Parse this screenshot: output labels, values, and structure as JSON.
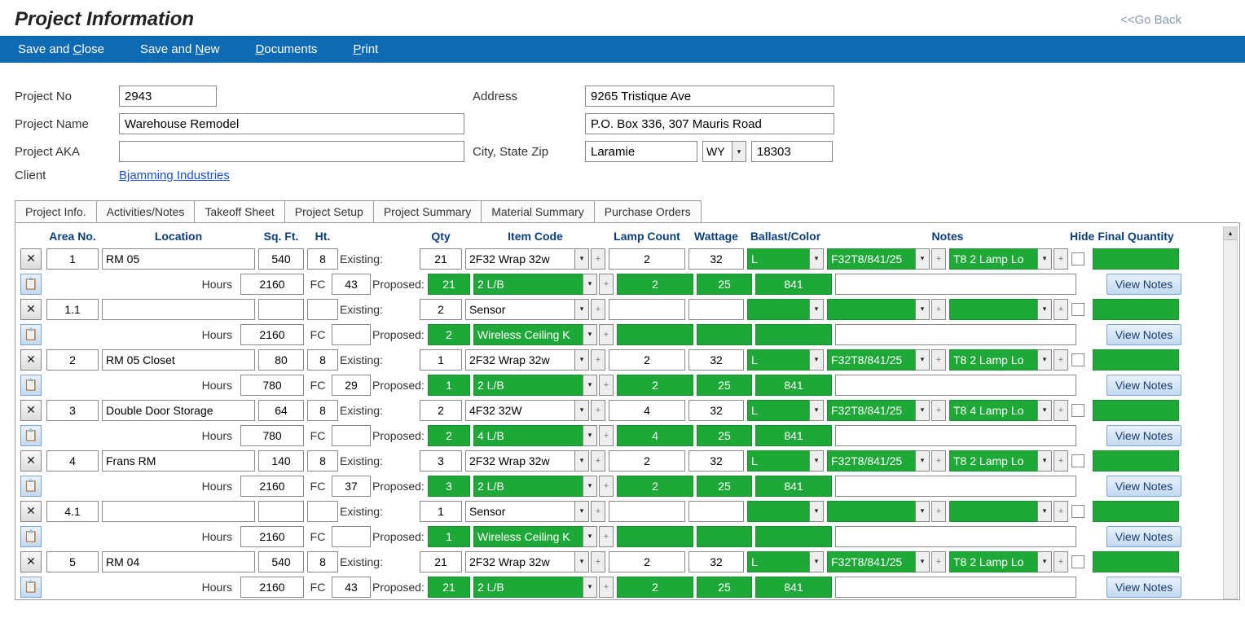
{
  "header": {
    "title": "Project Information",
    "go_back": "<<Go Back"
  },
  "toolbar": {
    "save_close": "Save and Close",
    "save_new": "Save and New",
    "documents": "Documents",
    "print": "Print"
  },
  "form": {
    "project_no_label": "Project No",
    "project_no": "2943",
    "project_name_label": "Project Name",
    "project_name": "Warehouse Remodel",
    "project_aka_label": "Project AKA",
    "project_aka": "",
    "client_label": "Client",
    "client": "Bjamming Industries",
    "address_label": "Address",
    "address1": "9265 Tristique Ave",
    "address2": "P.O. Box 336, 307 Mauris Road",
    "csz_label": "City, State Zip",
    "city": "Laramie",
    "state": "WY",
    "zip": "18303"
  },
  "tabs": [
    "Project Info.",
    "Activities/Notes",
    "Takeoff Sheet",
    "Project Setup",
    "Project Summary",
    "Material Summary",
    "Purchase Orders"
  ],
  "active_tab": 2,
  "columns": {
    "area": "Area No.",
    "location": "Location",
    "sqft": "Sq. Ft.",
    "ht": "Ht.",
    "qty": "Qty",
    "item": "Item Code",
    "lamp": "Lamp Count",
    "watt": "Wattage",
    "ballast": "Ballast/Color",
    "notes": "Notes",
    "hide": "Hide",
    "final": "Final Quantity"
  },
  "labels": {
    "existing": "Existing:",
    "proposed": "Proposed:",
    "hours": "Hours",
    "fc": "FC",
    "view_notes": "View Notes"
  },
  "rows": [
    {
      "area": "1",
      "location": "RM 05",
      "sqft": "540",
      "ht": "8",
      "hours": "2160",
      "fc": "43",
      "ex": {
        "qty": "21",
        "item": "2F32 Wrap 32w",
        "lamp": "2",
        "watt": "32",
        "bal": "L",
        "n1": "F32T8/841/25",
        "n2": "T8 2 Lamp Lo"
      },
      "pr": {
        "qty": "21",
        "item": "2 L/B",
        "lamp": "2",
        "watt": "25",
        "bal": "841"
      }
    },
    {
      "area": "1.1",
      "location": "",
      "sqft": "",
      "ht": "",
      "hours": "2160",
      "fc": "",
      "ex": {
        "qty": "2",
        "item": "Sensor",
        "lamp": "",
        "watt": "",
        "bal": "",
        "n1": "",
        "n2": ""
      },
      "pr": {
        "qty": "2",
        "item": "Wireless Ceiling K",
        "lamp": "",
        "watt": "",
        "bal": ""
      }
    },
    {
      "area": "2",
      "location": "RM 05 Closet",
      "sqft": "80",
      "ht": "8",
      "hours": "780",
      "fc": "29",
      "ex": {
        "qty": "1",
        "item": "2F32 Wrap 32w",
        "lamp": "2",
        "watt": "32",
        "bal": "L",
        "n1": "F32T8/841/25",
        "n2": "T8 2 Lamp Lo"
      },
      "pr": {
        "qty": "1",
        "item": "2 L/B",
        "lamp": "2",
        "watt": "25",
        "bal": "841"
      }
    },
    {
      "area": "3",
      "location": "Double Door Storage",
      "sqft": "64",
      "ht": "8",
      "hours": "780",
      "fc": "",
      "ex": {
        "qty": "2",
        "item": "4F32 32W",
        "lamp": "4",
        "watt": "32",
        "bal": "L",
        "n1": "F32T8/841/25",
        "n2": "T8 4 Lamp Lo"
      },
      "pr": {
        "qty": "2",
        "item": "4 L/B",
        "lamp": "4",
        "watt": "25",
        "bal": "841"
      }
    },
    {
      "area": "4",
      "location": "Frans RM",
      "sqft": "140",
      "ht": "8",
      "hours": "2160",
      "fc": "37",
      "ex": {
        "qty": "3",
        "item": "2F32 Wrap 32w",
        "lamp": "2",
        "watt": "32",
        "bal": "L",
        "n1": "F32T8/841/25",
        "n2": "T8 2 Lamp Lo"
      },
      "pr": {
        "qty": "3",
        "item": "2 L/B",
        "lamp": "2",
        "watt": "25",
        "bal": "841"
      }
    },
    {
      "area": "4.1",
      "location": "",
      "sqft": "",
      "ht": "",
      "hours": "2160",
      "fc": "",
      "ex": {
        "qty": "1",
        "item": "Sensor",
        "lamp": "",
        "watt": "",
        "bal": "",
        "n1": "",
        "n2": ""
      },
      "pr": {
        "qty": "1",
        "item": "Wireless Ceiling K",
        "lamp": "",
        "watt": "",
        "bal": ""
      }
    },
    {
      "area": "5",
      "location": "RM 04",
      "sqft": "540",
      "ht": "8",
      "hours": "2160",
      "fc": "43",
      "ex": {
        "qty": "21",
        "item": "2F32 Wrap 32w",
        "lamp": "2",
        "watt": "32",
        "bal": "L",
        "n1": "F32T8/841/25",
        "n2": "T8 2 Lamp Lo"
      },
      "pr": {
        "qty": "21",
        "item": "2 L/B",
        "lamp": "2",
        "watt": "25",
        "bal": "841"
      }
    }
  ]
}
